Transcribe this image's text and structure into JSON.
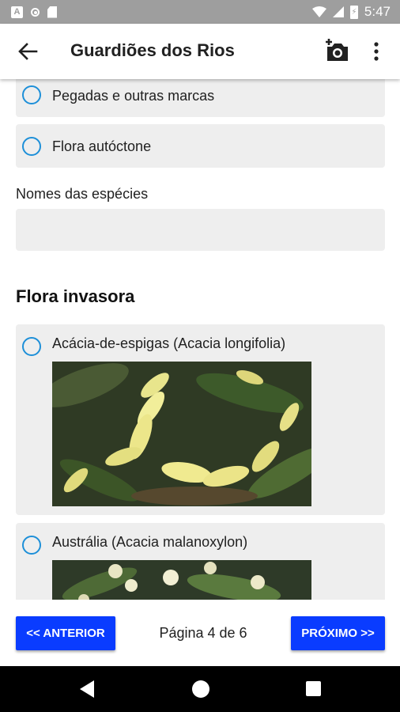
{
  "status_bar": {
    "time": "5:47",
    "notification_letter": "A",
    "battery_glyph": "⚡"
  },
  "app_bar": {
    "title": "Guardiões dos Rios"
  },
  "options_top": [
    {
      "label": "Pegadas e outras marcas"
    },
    {
      "label": "Flora autóctone"
    }
  ],
  "species_field": {
    "label": "Nomes das espécies",
    "value": ""
  },
  "invasive_section": {
    "title": "Flora invasora",
    "options": [
      {
        "label": "Acácia-de-espigas (Acacia longifolia)"
      },
      {
        "label": "Austrália (Acacia malanoxylon)"
      }
    ]
  },
  "pagination": {
    "prev_label": "<< ANTERIOR",
    "next_label": "PRÓXIMO >>",
    "page_text": "Página 4 de 6"
  },
  "colors": {
    "accent_blue": "#0a3cff",
    "radio_blue": "#1d8fd8",
    "card_gray": "#eeeeee"
  }
}
